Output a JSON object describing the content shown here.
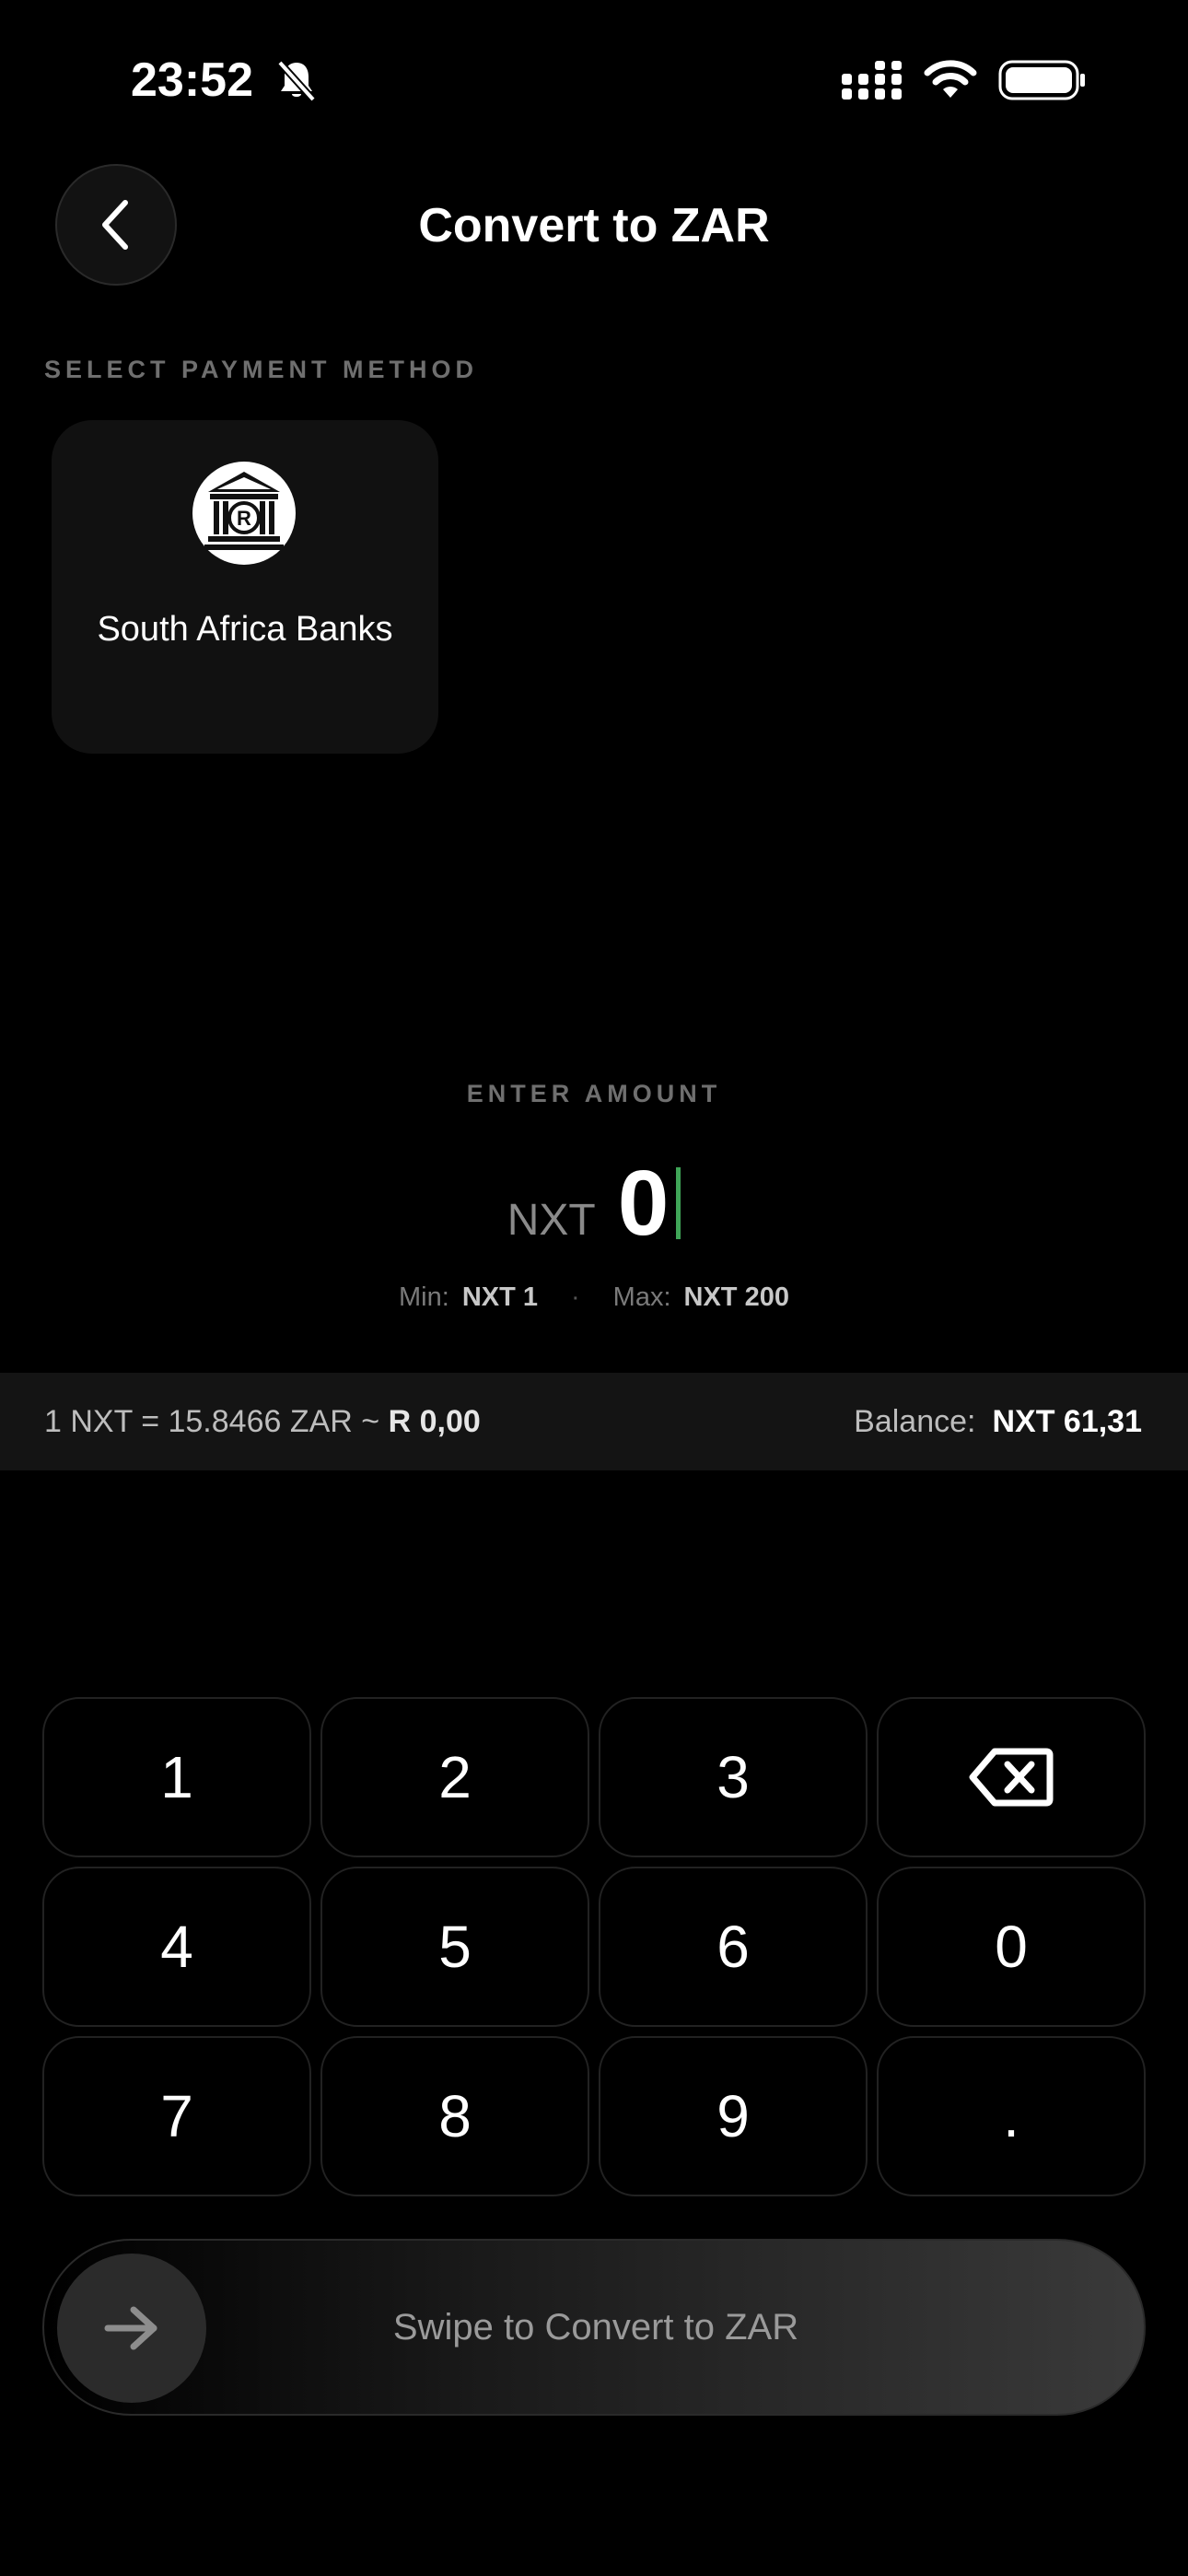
{
  "status_bar": {
    "time": "23:52"
  },
  "header": {
    "title": "Convert to ZAR"
  },
  "payment": {
    "section_label": "SELECT PAYMENT METHOD",
    "methods": [
      {
        "label": "South Africa Banks",
        "icon": "bank-icon"
      }
    ]
  },
  "amount": {
    "section_label": "ENTER AMOUNT",
    "currency": "NXT",
    "value": "0",
    "min_label": "Min:",
    "min_value": "NXT 1",
    "max_label": "Max:",
    "max_value": "NXT 200",
    "separator": "·"
  },
  "info_bar": {
    "rate": "1 NXT = 15.8466 ZAR ~ ",
    "rate_zar": "R 0,00",
    "balance_label": "Balance:",
    "balance_value": "NXT 61,31"
  },
  "keypad": {
    "keys": [
      "1",
      "2",
      "3",
      "delete",
      "4",
      "5",
      "6",
      "0",
      "7",
      "8",
      "9",
      "."
    ]
  },
  "swipe": {
    "label": "Swipe to Convert to ZAR"
  },
  "colors": {
    "background": "#000000",
    "caret": "#3fa557",
    "card": "#111111"
  }
}
